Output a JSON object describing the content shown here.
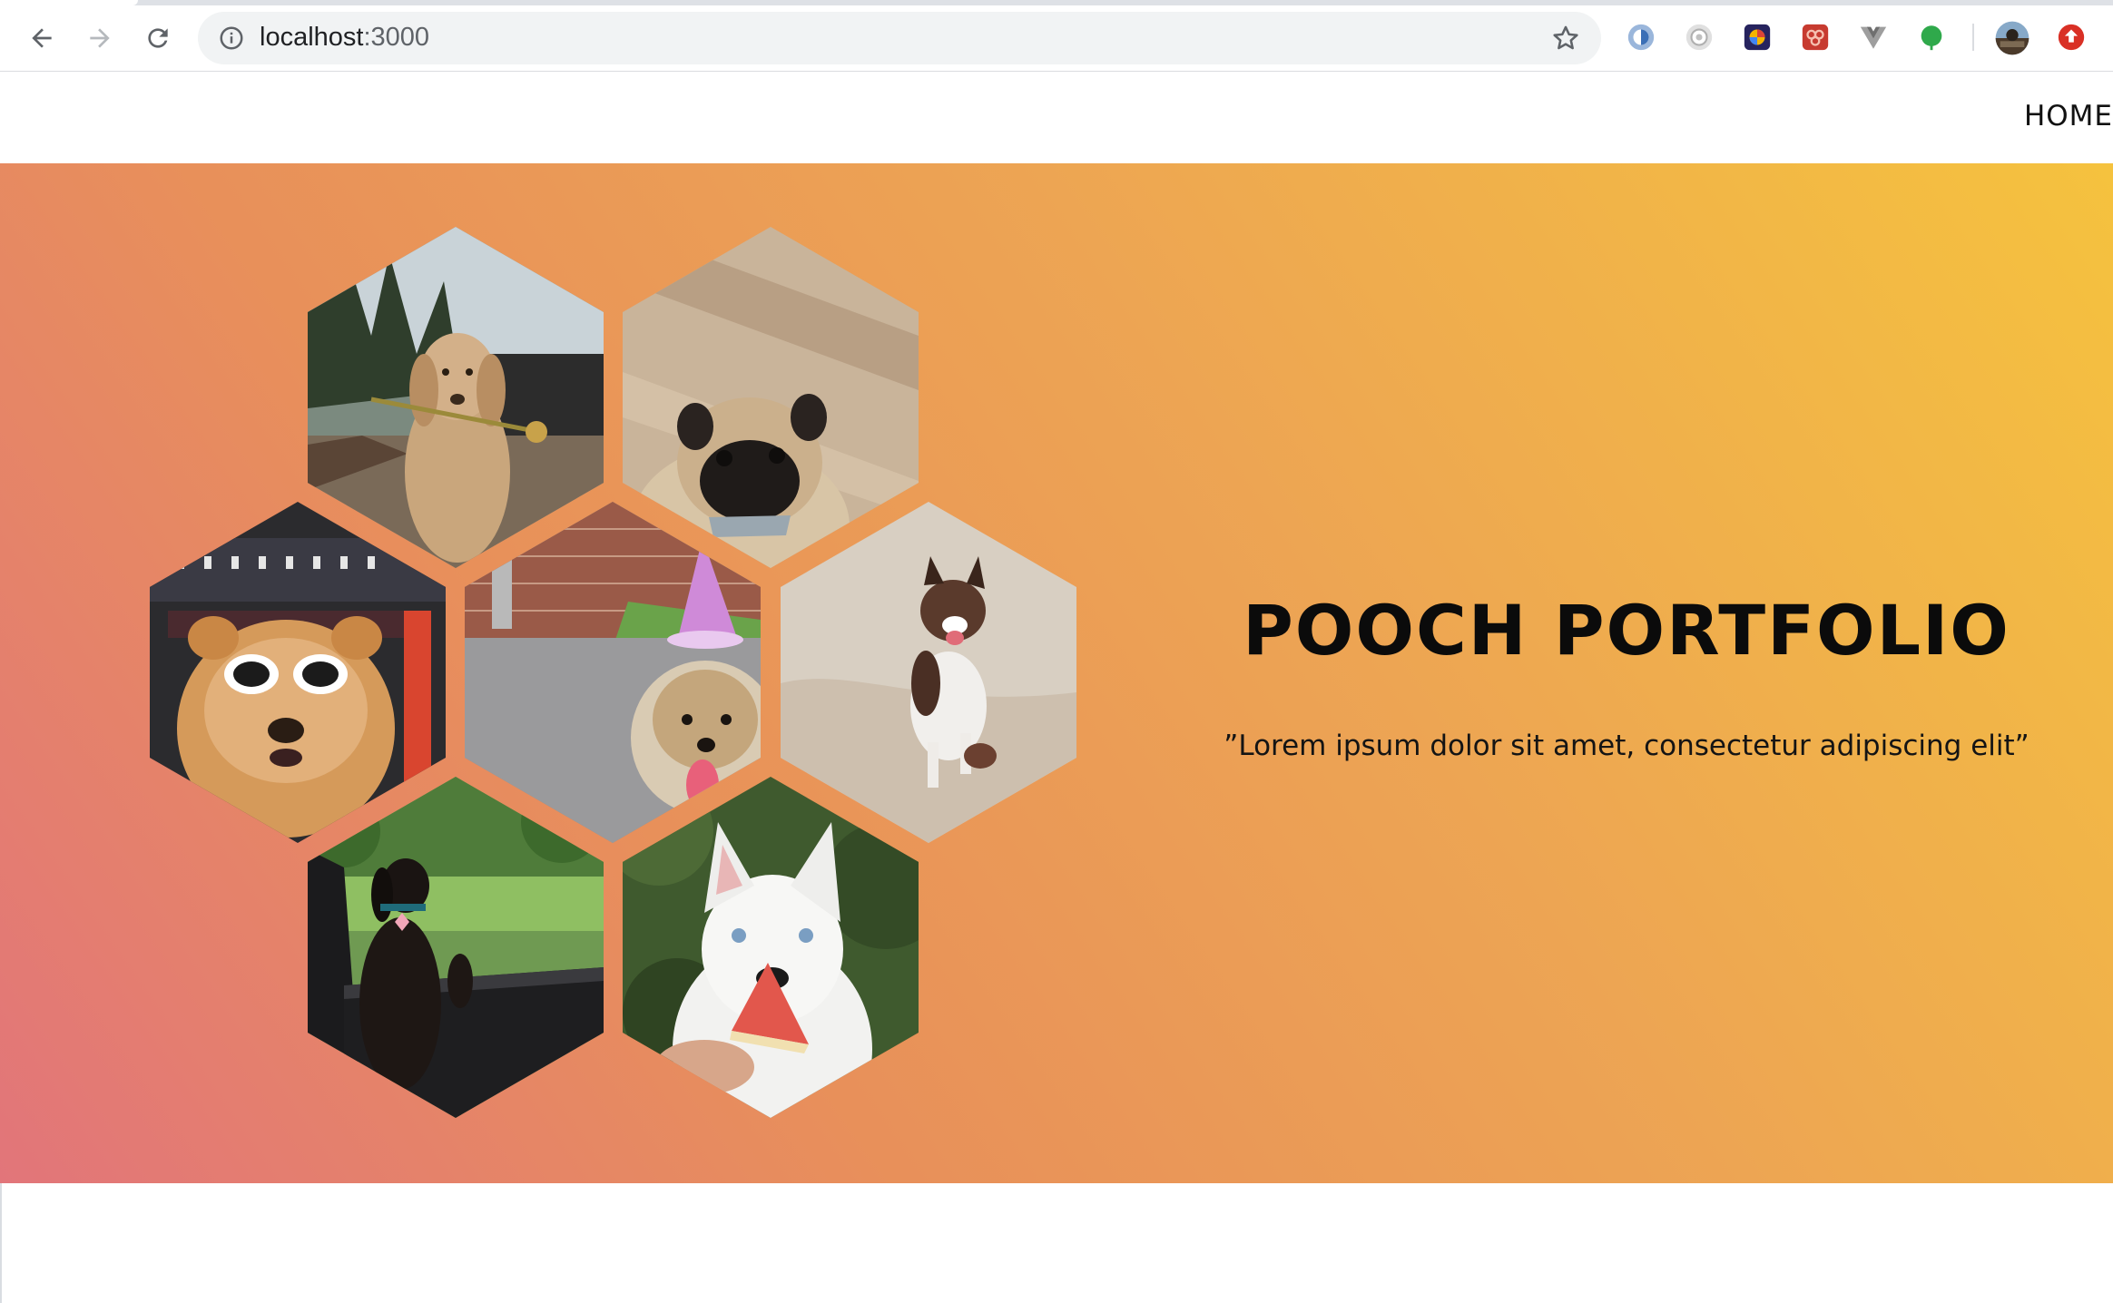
{
  "browser": {
    "url_host": "localhost",
    "url_port": ":3000",
    "icons": [
      "back-arrow-icon",
      "forward-arrow-icon",
      "reload-icon",
      "info-icon",
      "bookmark-star-icon"
    ]
  },
  "extensions": [
    {
      "name": "extension-blue-circle-icon",
      "color": "#4a7fc1"
    },
    {
      "name": "extension-grey-camera-icon",
      "color": "#bdbdbd"
    },
    {
      "name": "extension-dark-grid-icon",
      "color": "#2b2a6b"
    },
    {
      "name": "extension-red-redux-icon",
      "color": "#cc3b2f"
    },
    {
      "name": "extension-vue-v-icon",
      "color": "#8a8a8a"
    },
    {
      "name": "extension-green-leaf-icon",
      "color": "#34a853"
    },
    {
      "name": "profile-avatar",
      "color": "#6b5a48"
    },
    {
      "name": "extension-red-upload-icon",
      "color": "#d93025"
    }
  ],
  "nav": {
    "home_label": "HOME"
  },
  "hero": {
    "title": "POOCH PORTFOLIO",
    "subtitle": "”Lorem ipsum dolor sit amet, consectetur adipiscing elit”",
    "gradient": [
      "#e2757a",
      "#e8905a",
      "#eda553",
      "#f5c23e"
    ]
  },
  "gallery": [
    {
      "name": "golden-retriever-with-rose"
    },
    {
      "name": "pug-with-toy"
    },
    {
      "name": "chow-chow-with-sunglasses"
    },
    {
      "name": "terrier-with-party-hat"
    },
    {
      "name": "australian-shepherd-running"
    },
    {
      "name": "dachshund-in-car"
    },
    {
      "name": "husky-with-watermelon"
    }
  ]
}
